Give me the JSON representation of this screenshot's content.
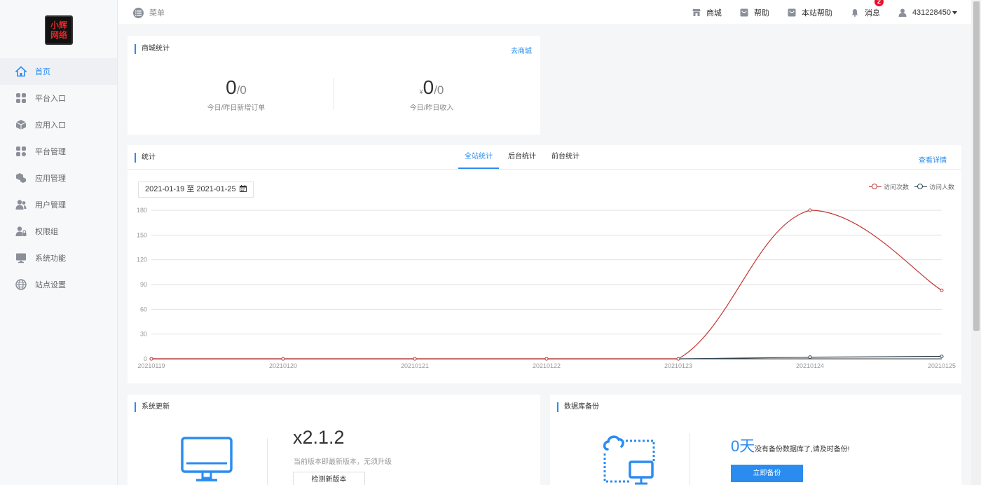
{
  "logo": {
    "line1": "小辉",
    "line2": "网络"
  },
  "sidebar": {
    "items": [
      {
        "label": "首页",
        "icon": "home-icon"
      },
      {
        "label": "平台入口",
        "icon": "grid-icon"
      },
      {
        "label": "应用入口",
        "icon": "cube-icon"
      },
      {
        "label": "平台管理",
        "icon": "grid-settings-icon"
      },
      {
        "label": "应用管理",
        "icon": "cubes-icon"
      },
      {
        "label": "用户管理",
        "icon": "users-icon"
      },
      {
        "label": "权限组",
        "icon": "user-lock-icon"
      },
      {
        "label": "系统功能",
        "icon": "monitor-icon"
      },
      {
        "label": "站点设置",
        "icon": "globe-icon"
      }
    ]
  },
  "topbar": {
    "menu_label": "菜单",
    "links": [
      {
        "label": "商城",
        "icon": "store-icon"
      },
      {
        "label": "帮助",
        "icon": "help-icon"
      },
      {
        "label": "本站帮助",
        "icon": "site-help-icon"
      },
      {
        "label": "消息",
        "icon": "bell-icon"
      }
    ],
    "badge": "2",
    "user": "431228450"
  },
  "shop_stats": {
    "title": "商城统计",
    "link": "去商城",
    "orders": {
      "today": "0",
      "yesterday": "/0",
      "label": "今日/昨日新增订单"
    },
    "income": {
      "currency": "¥",
      "today": "0",
      "yesterday": "/0",
      "label": "今日/昨日收入"
    }
  },
  "stats": {
    "title": "统计",
    "tabs": [
      "全站统计",
      "后台统计",
      "前台统计"
    ],
    "link": "查看详情",
    "date_range": "2021-01-19 至 2021-01-25"
  },
  "chart_data": {
    "type": "line",
    "x": [
      "20210119",
      "20210120",
      "20210121",
      "20210122",
      "20210123",
      "20210124",
      "20210125"
    ],
    "series": [
      {
        "name": "访问次数",
        "color": "#c23531",
        "values": [
          0,
          0,
          0,
          0,
          0,
          180,
          83
        ]
      },
      {
        "name": "访问人数",
        "color": "#2f4554",
        "values": [
          0,
          0,
          0,
          0,
          0,
          2,
          3
        ]
      }
    ],
    "yticks": [
      0,
      30,
      60,
      90,
      120,
      150,
      180
    ],
    "ylim": [
      0,
      180
    ],
    "grid": true,
    "legend": "top-right",
    "smooth": true
  },
  "update": {
    "title": "系统更新",
    "version": "x2.1.2",
    "note": "当前版本即最新版本，无须升级",
    "button": "检测新版本"
  },
  "backup": {
    "title": "数据库备份",
    "days": "0天",
    "message": "没有备份数据库了,请及时备份!",
    "button": "立即备份"
  },
  "colors": {
    "accent": "#2b8cf0",
    "badge": "#e8112d"
  }
}
